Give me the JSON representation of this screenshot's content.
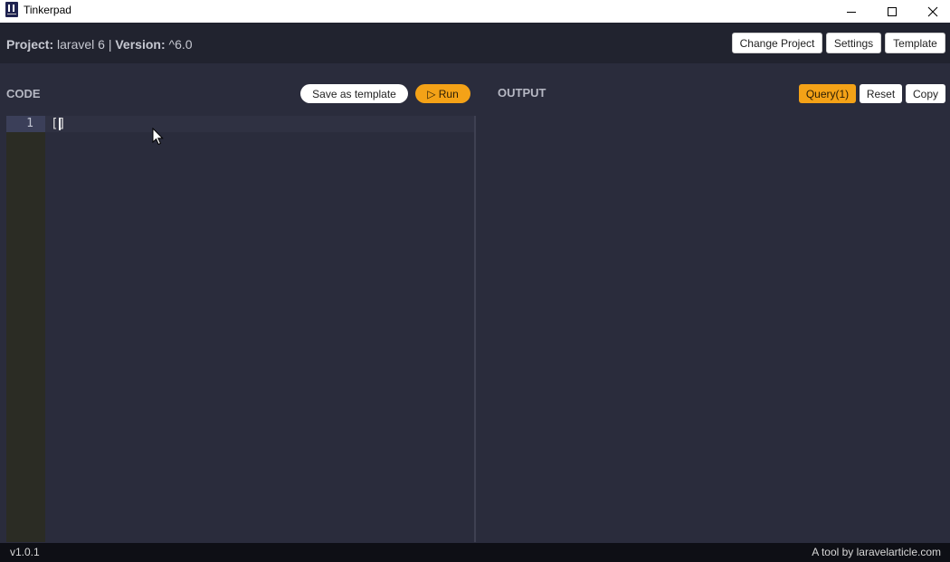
{
  "window": {
    "title": "Tinkerpad",
    "icons": {
      "app": "tinkerpad-logo-icon",
      "minimize": "minimize-icon",
      "maximize": "maximize-icon",
      "close": "close-icon"
    }
  },
  "header": {
    "project_label": "Project:",
    "project_value": "laravel 6",
    "separator": "|",
    "version_label": "Version:",
    "version_value": "^6.0",
    "buttons": {
      "change_project": "Change Project",
      "settings": "Settings",
      "template": "Template"
    }
  },
  "code_panel": {
    "label": "CODE",
    "save_template": "Save as template",
    "run": "▷ Run",
    "line_numbers": [
      "1"
    ],
    "lines": [
      "[]"
    ]
  },
  "output_panel": {
    "label": "OUTPUT",
    "query": "Query(1)",
    "reset": "Reset",
    "copy": "Copy"
  },
  "footer": {
    "version": "v1.0.1",
    "credit": "A tool by laravelarticle.com"
  },
  "colors": {
    "accent": "#f4a217",
    "background": "#2a2c3c",
    "header_bg": "#21232f",
    "footer_bg": "#0e0f15",
    "gutter_bg": "#2b2c24"
  }
}
